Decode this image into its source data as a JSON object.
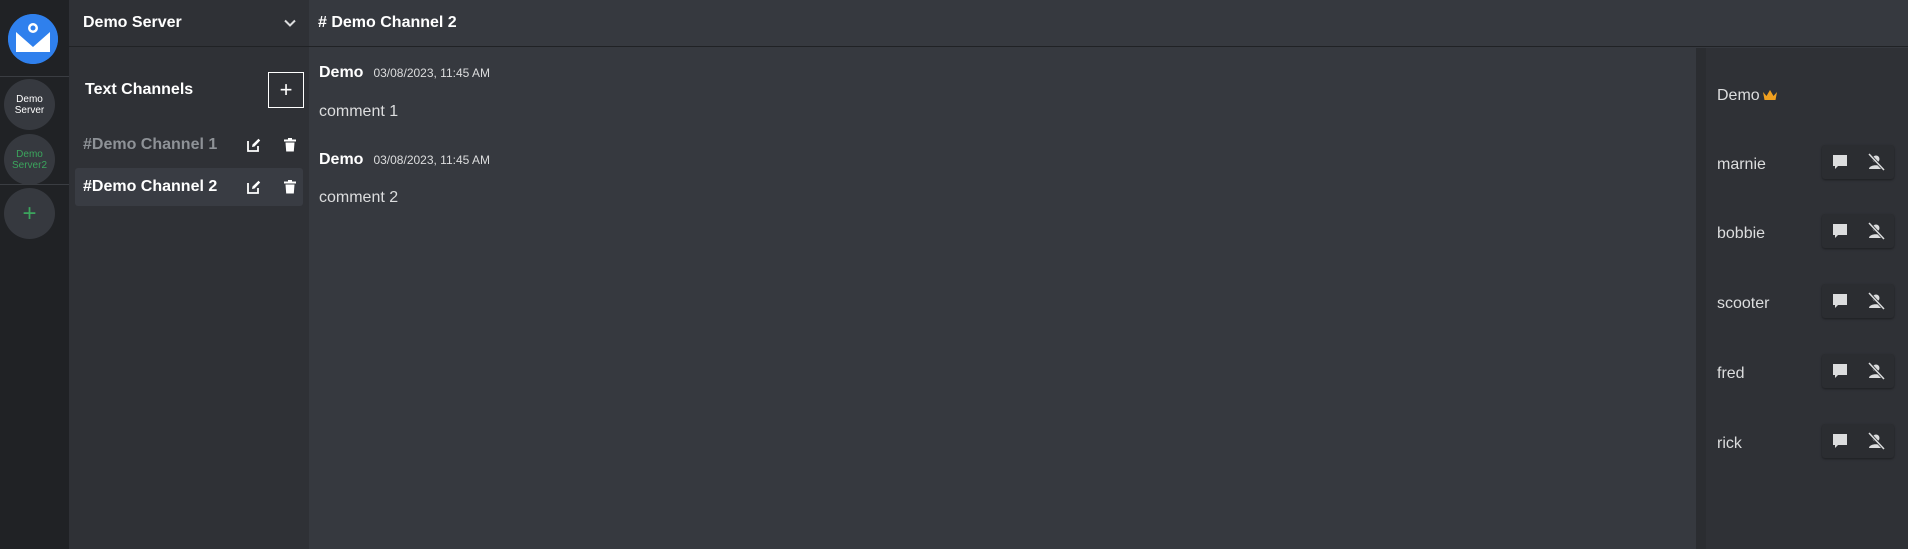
{
  "servers": [
    {
      "label": "Demo Server",
      "color": "#ffffff"
    },
    {
      "label": "Demo Server2",
      "color": "#3ba55d"
    }
  ],
  "add_server_label": "+",
  "sidebar": {
    "server_name": "Demo Server",
    "section_title": "Text Channels",
    "add_channel_label": "+",
    "channels": [
      {
        "name": "#Demo Channel 1",
        "active": false,
        "color": "#8e9297"
      },
      {
        "name": "#Demo Channel 2",
        "active": true,
        "color": "#ffffff"
      }
    ]
  },
  "header": {
    "title": "# Demo Channel 2"
  },
  "messages": [
    {
      "author": "Demo",
      "timestamp": "03/08/2023, 11:45 AM",
      "text": "comment 1"
    },
    {
      "author": "Demo",
      "timestamp": "03/08/2023, 11:45 AM",
      "text": "comment 2"
    }
  ],
  "members": {
    "owner": {
      "name": "Demo",
      "badge_icon": "crown-icon"
    },
    "users": [
      {
        "name": "marnie"
      },
      {
        "name": "bobbie"
      },
      {
        "name": "scooter"
      },
      {
        "name": "fred"
      },
      {
        "name": "rick"
      }
    ],
    "action_icons": [
      "message-icon",
      "kick-user-icon"
    ]
  },
  "colors": {
    "accent": "#2f80ed",
    "online_green": "#3ba55d",
    "crown": "#f0a020"
  }
}
